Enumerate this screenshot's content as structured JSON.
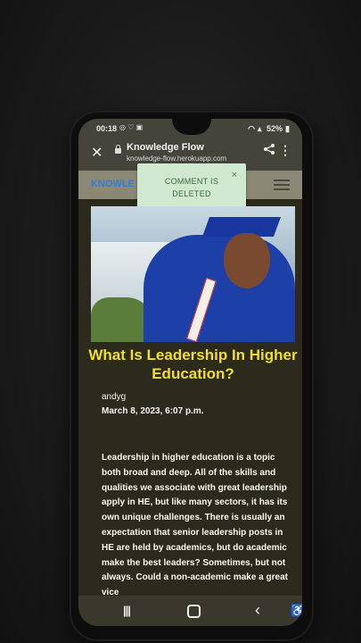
{
  "status_bar": {
    "time": "00:18",
    "battery": "52%"
  },
  "browser": {
    "page_title": "Knowledge Flow",
    "url": "knowledge-flow.herokuapp.com"
  },
  "site": {
    "brand": "KNOWLE"
  },
  "toast": {
    "message_line1": "COMMENT IS",
    "message_line2": "DELETED",
    "close": "×"
  },
  "article": {
    "title": "What Is Leadership In Higher Education?",
    "author": "andyg",
    "date": "March 8, 2023, 6:07 p.m.",
    "body": "Leadership in higher education is a topic both broad and deep. All of the skills and qualities we associate with great leadership apply in HE, but like many sectors, it has its own unique challenges. There is usually an expectation that senior leadership posts in HE are held by academics, but do academic make the best leaders? Sometimes, but not always. Could a non-academic make a great vice"
  },
  "nav": {
    "recents": "|||",
    "back": "‹"
  },
  "colors": {
    "title_yellow": "#f1df28",
    "brand_blue": "#2f7fd6",
    "toast_bg": "#cfe8cf"
  }
}
